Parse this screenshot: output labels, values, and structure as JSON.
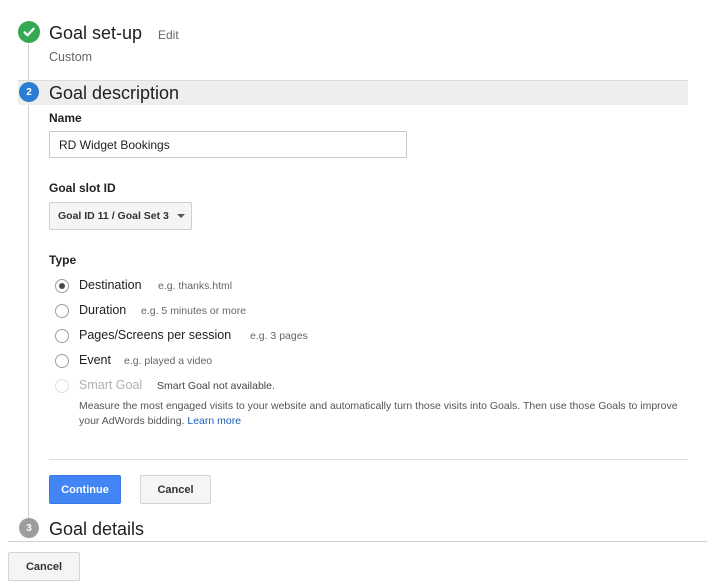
{
  "step1": {
    "number_icon": "check-icon",
    "title": "Goal set-up",
    "edit_link": "Edit",
    "subtitle": "Custom"
  },
  "step2": {
    "number": "2",
    "title": "Goal description"
  },
  "name_field": {
    "label": "Name",
    "value": "RD Widget Bookings"
  },
  "goal_slot": {
    "label": "Goal slot ID",
    "selected": "Goal ID 11 / Goal Set 3"
  },
  "type": {
    "label": "Type",
    "options": [
      {
        "label": "Destination",
        "hint": "e.g. thanks.html",
        "checked": true
      },
      {
        "label": "Duration",
        "hint": "e.g. 5 minutes or more",
        "checked": false
      },
      {
        "label": "Pages/Screens per session",
        "hint": "e.g. 3 pages",
        "checked": false
      },
      {
        "label": "Event",
        "hint": "e.g. played a video",
        "checked": false
      },
      {
        "label": "Smart Goal",
        "hint": "Smart Goal not available.",
        "checked": false,
        "disabled": true
      }
    ],
    "smart_goal_description": "Measure the most engaged visits to your website and automatically turn those visits into Goals. Then use those Goals to improve your AdWords bidding.",
    "learn_more": "Learn more"
  },
  "actions": {
    "continue": "Continue",
    "cancel": "Cancel"
  },
  "step3": {
    "number": "3",
    "title": "Goal details"
  },
  "footer": {
    "cancel": "Cancel"
  },
  "colors": {
    "accent": "#4285f4",
    "done": "#34a853",
    "step_active": "#2a7dd2",
    "step_inactive": "#9e9e9e"
  }
}
